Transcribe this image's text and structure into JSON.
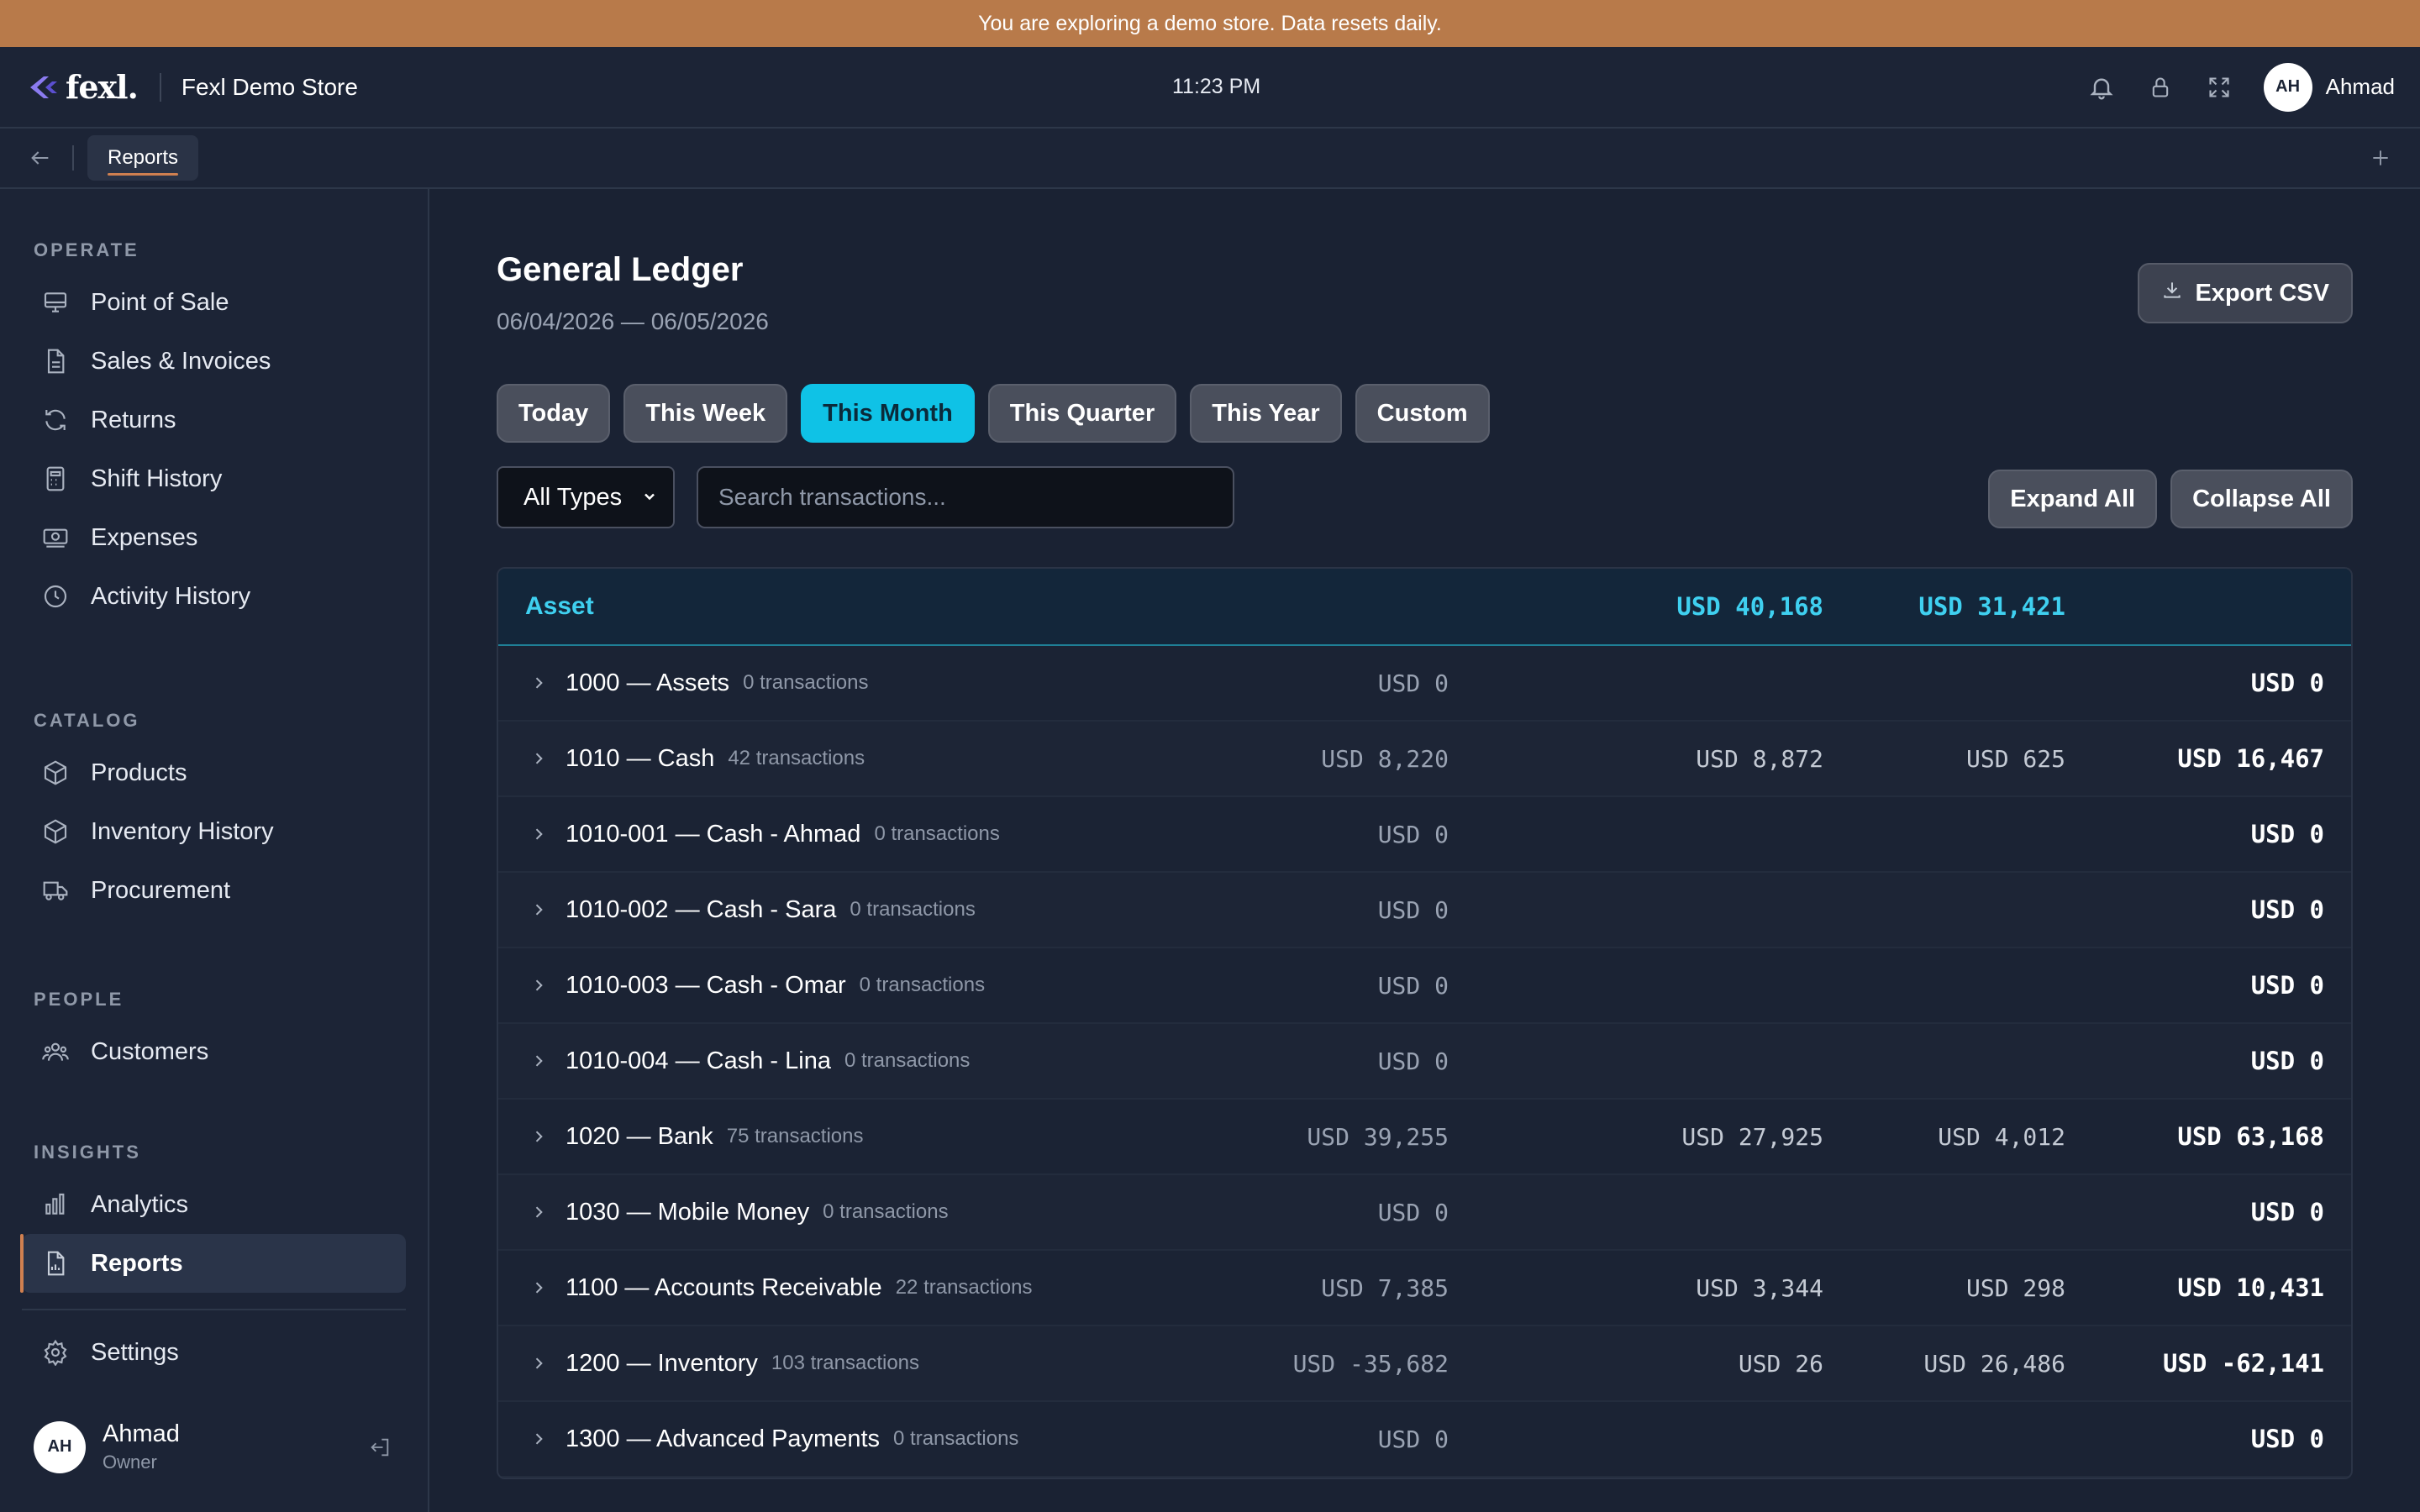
{
  "banner": {
    "text": "You are exploring a demo store. Data resets daily."
  },
  "header": {
    "logo": "fexl.",
    "store_name": "Fexl Demo Store",
    "clock": "11:23 PM",
    "user_initials": "AH",
    "user_name": "Ahmad"
  },
  "tabs": {
    "active": "Reports"
  },
  "sidebar": {
    "sections": [
      {
        "label": "OPERATE",
        "items": [
          "Point of Sale",
          "Sales & Invoices",
          "Returns",
          "Shift History",
          "Expenses",
          "Activity History"
        ]
      },
      {
        "label": "CATALOG",
        "items": [
          "Products",
          "Inventory History",
          "Procurement"
        ]
      },
      {
        "label": "PEOPLE",
        "items": [
          "Customers"
        ]
      },
      {
        "label": "INSIGHTS",
        "items": [
          "Analytics",
          "Reports"
        ]
      }
    ],
    "settings": "Settings",
    "user": {
      "initials": "AH",
      "name": "Ahmad",
      "role": "Owner"
    }
  },
  "main": {
    "title": "General Ledger",
    "daterange": "06/04/2026 — 06/05/2026",
    "export_label": "Export CSV",
    "periods": [
      "Today",
      "This Week",
      "This Month",
      "This Quarter",
      "This Year",
      "Custom"
    ],
    "active_period": "This Month",
    "type_filter": "All Types",
    "search_placeholder": "Search transactions...",
    "expand_all": "Expand All",
    "collapse_all": "Collapse All"
  },
  "ledger": {
    "group_name": "Asset",
    "group_debit": "USD 40,168",
    "group_credit": "USD 31,421",
    "rows": [
      {
        "account": "1000 — Assets",
        "count": "0 transactions",
        "opening": "USD 0",
        "debit": "",
        "credit": "",
        "closing": "USD 0"
      },
      {
        "account": "1010 — Cash",
        "count": "42 transactions",
        "opening": "USD 8,220",
        "debit": "USD 8,872",
        "credit": "USD 625",
        "closing": "USD 16,467"
      },
      {
        "account": "1010-001 — Cash - Ahmad",
        "count": "0 transactions",
        "opening": "USD 0",
        "debit": "",
        "credit": "",
        "closing": "USD 0"
      },
      {
        "account": "1010-002 — Cash - Sara",
        "count": "0 transactions",
        "opening": "USD 0",
        "debit": "",
        "credit": "",
        "closing": "USD 0"
      },
      {
        "account": "1010-003 — Cash - Omar",
        "count": "0 transactions",
        "opening": "USD 0",
        "debit": "",
        "credit": "",
        "closing": "USD 0"
      },
      {
        "account": "1010-004 — Cash - Lina",
        "count": "0 transactions",
        "opening": "USD 0",
        "debit": "",
        "credit": "",
        "closing": "USD 0"
      },
      {
        "account": "1020 — Bank",
        "count": "75 transactions",
        "opening": "USD 39,255",
        "debit": "USD 27,925",
        "credit": "USD 4,012",
        "closing": "USD 63,168"
      },
      {
        "account": "1030 — Mobile Money",
        "count": "0 transactions",
        "opening": "USD 0",
        "debit": "",
        "credit": "",
        "closing": "USD 0"
      },
      {
        "account": "1100 — Accounts Receivable",
        "count": "22 transactions",
        "opening": "USD 7,385",
        "debit": "USD 3,344",
        "credit": "USD 298",
        "closing": "USD 10,431"
      },
      {
        "account": "1200 — Inventory",
        "count": "103 transactions",
        "opening": "USD -35,682",
        "debit": "USD 26",
        "credit": "USD 26,486",
        "closing": "USD -62,141"
      },
      {
        "account": "1300 — Advanced Payments",
        "count": "0 transactions",
        "opening": "USD 0",
        "debit": "",
        "credit": "",
        "closing": "USD 0"
      }
    ]
  },
  "colors": {
    "accent": "#0fc2e6",
    "banner": "#b87a4a",
    "active_marker": "#d08050"
  }
}
